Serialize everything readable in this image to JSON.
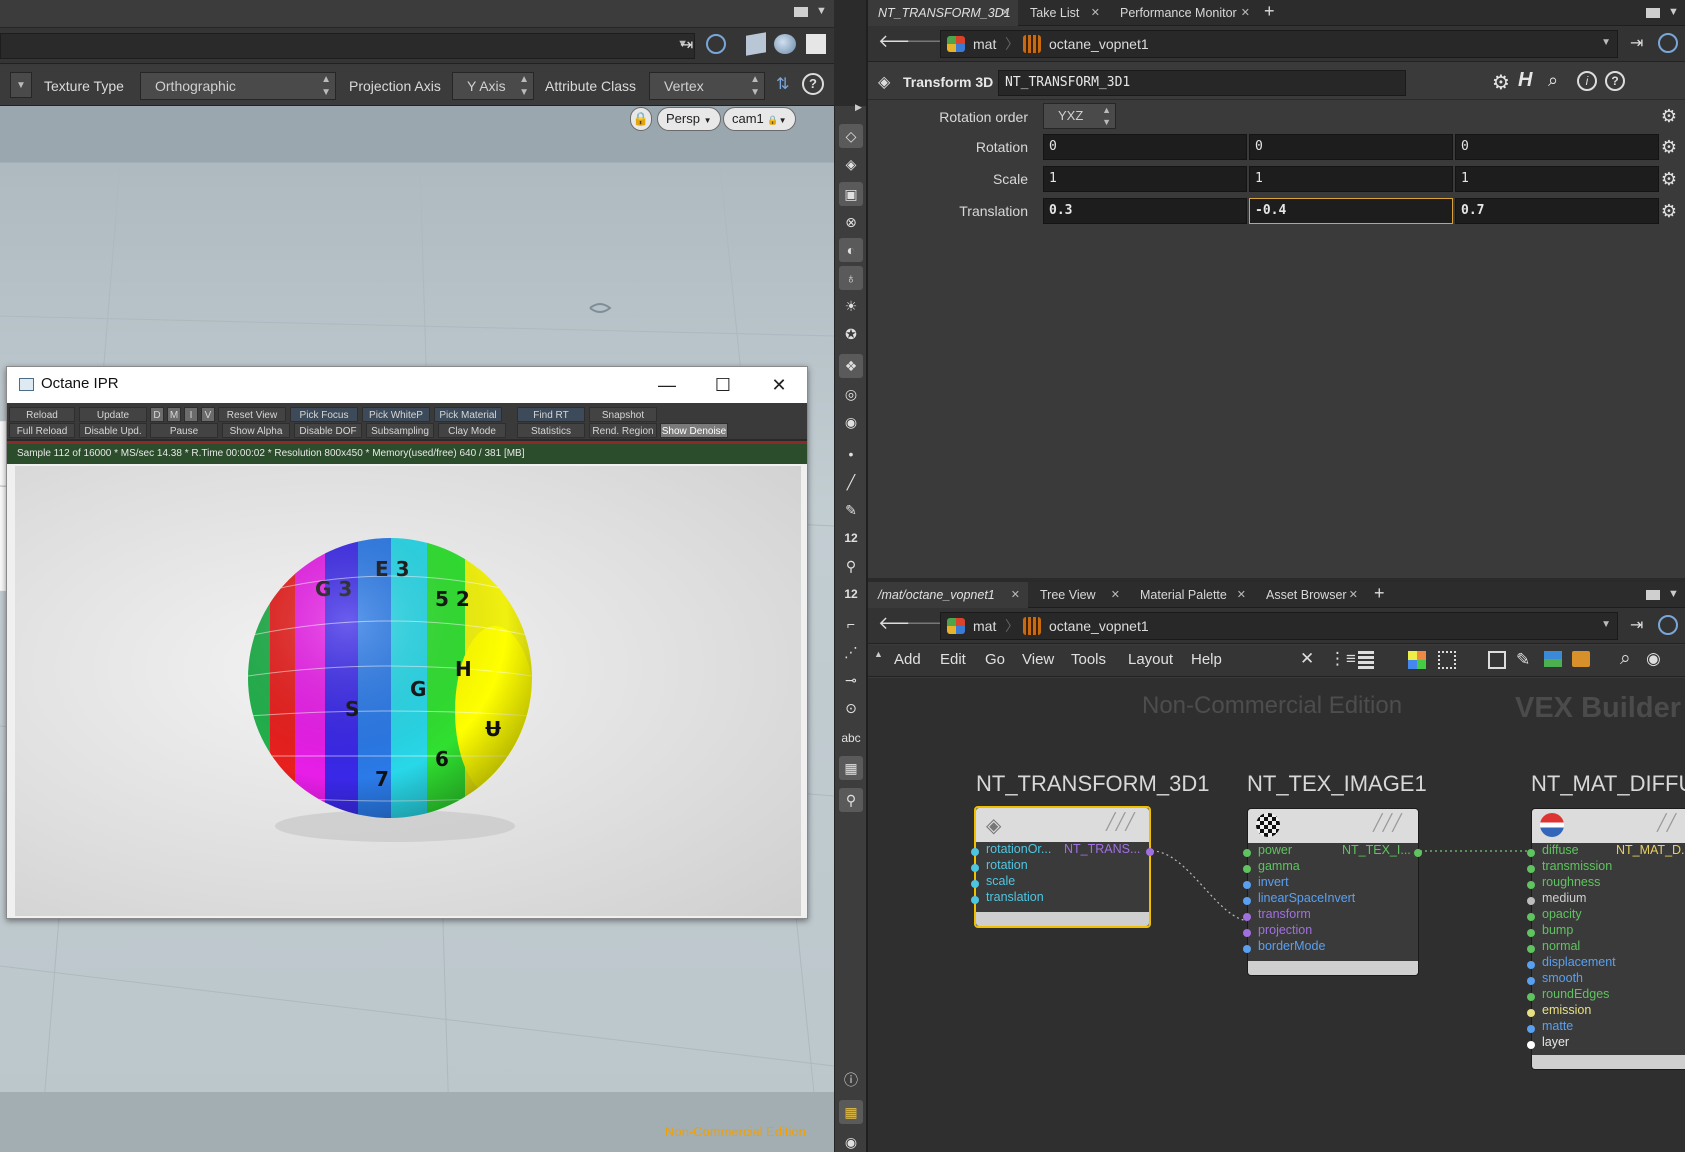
{
  "left": {
    "param_row": {
      "texture_type_label": "Texture Type",
      "texture_type_value": "Orthographic",
      "projection_axis_label": "Projection Axis",
      "projection_axis_value": "Y Axis",
      "attribute_class_label": "Attribute Class",
      "attribute_class_value": "Vertex"
    },
    "viewport": {
      "persp_label": "Persp",
      "cam_label": "cam1",
      "watermark": "Non-Commercial Edition"
    },
    "shelf_labels": {
      "n12a": "12",
      "n12b": "12",
      "abc": "abc"
    }
  },
  "ipr": {
    "title": "Octane IPR",
    "toolbar_row1": [
      "Reload",
      "Update",
      "D",
      "M",
      "I",
      "V",
      "Reset View",
      "Pick Focus",
      "Pick WhiteP",
      "Pick Material",
      "Find RT",
      "Snapshot"
    ],
    "toolbar_row2": [
      "Full Reload",
      "Disable Upd.",
      "Pause",
      "Show Alpha",
      "Disable DOF",
      "Subsampling",
      "Clay Mode",
      "Statistics",
      "Rend. Region",
      "Show Denoise"
    ],
    "status": "Sample 112 of 16000 * MS/sec 14.38 * R.Time 00:00:02 * Resolution 800x450 * Memory(used/free) 640 / 381 [MB]"
  },
  "params": {
    "tabs": [
      "NT_TRANSFORM_3D1",
      "Take List",
      "Performance Monitor"
    ],
    "path_root": "mat",
    "path_node": "octane_vopnet1",
    "node_type": "Transform 3D",
    "node_name": "NT_TRANSFORM_3D1",
    "rotation_order_label": "Rotation order",
    "rotation_order_value": "YXZ",
    "rotation_label": "Rotation",
    "rotation": [
      "0",
      "0",
      "0"
    ],
    "scale_label": "Scale",
    "scale": [
      "1",
      "1",
      "1"
    ],
    "translation_label": "Translation",
    "translation": [
      "0.3",
      "-0.4",
      "0.7"
    ]
  },
  "network": {
    "tabs": [
      "/mat/octane_vopnet1",
      "Tree View",
      "Material Palette",
      "Asset Browser"
    ],
    "path_root": "mat",
    "path_node": "octane_vopnet1",
    "menu": [
      "Add",
      "Edit",
      "Go",
      "View",
      "Tools",
      "Layout",
      "Help"
    ],
    "watermark_nc": "Non-Commercial Edition",
    "watermark_vex": "VEX Builder",
    "nodes": {
      "transform": {
        "title": "NT_TRANSFORM_3D1",
        "output": "NT_TRANS...",
        "inputs": [
          "rotationOr...",
          "rotation",
          "scale",
          "translation"
        ]
      },
      "tex_image": {
        "title": "NT_TEX_IMAGE1",
        "output": "NT_TEX_I...",
        "inputs": [
          "power",
          "gamma",
          "invert",
          "linearSpaceInvert",
          "transform",
          "projection",
          "borderMode"
        ]
      },
      "mat_diffuse": {
        "title": "NT_MAT_DIFFU",
        "output": "NT_MAT_D...",
        "inputs": [
          "diffuse",
          "transmission",
          "roughness",
          "medium",
          "opacity",
          "bump",
          "normal",
          "displacement",
          "smooth",
          "roundEdges",
          "emission",
          "matte",
          "layer"
        ]
      }
    }
  },
  "colors": {
    "accent_focus": "#d9a33a",
    "selected_node": "#f0c000",
    "port_green": "#5fc35f",
    "port_cyan": "#4fc6e0",
    "port_blue": "#5aa0f0",
    "port_purple": "#a070e0",
    "watermark_orange": "#f0a000"
  }
}
